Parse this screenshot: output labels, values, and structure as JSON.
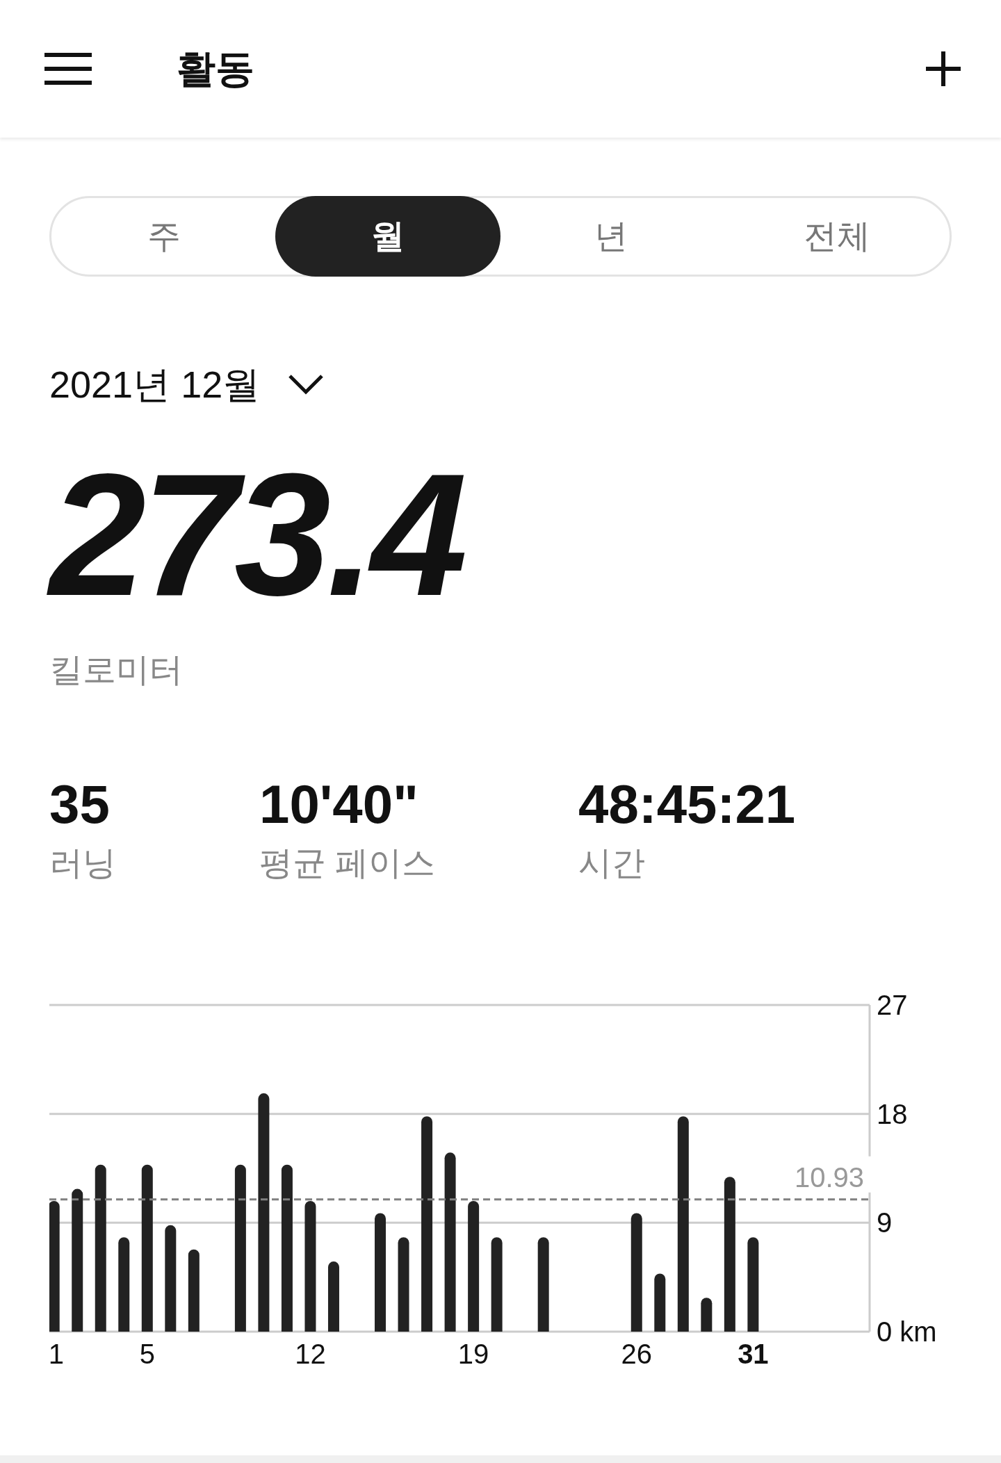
{
  "header": {
    "title": "활동"
  },
  "tabs": [
    {
      "label": "주",
      "selected": false
    },
    {
      "label": "월",
      "selected": true
    },
    {
      "label": "년",
      "selected": false
    },
    {
      "label": "전체",
      "selected": false
    }
  ],
  "period": {
    "label": "2021년 12월"
  },
  "total": {
    "value": "273.4",
    "unit": "킬로미터"
  },
  "stats": [
    {
      "value": "35",
      "label": "러닝"
    },
    {
      "value": "10'40\"",
      "label": "평균 페이스"
    },
    {
      "value": "48:45:21",
      "label": "시간"
    }
  ],
  "chart": {
    "chart_data": {
      "type": "bar",
      "x": [
        1,
        2,
        3,
        4,
        5,
        6,
        7,
        8,
        9,
        10,
        11,
        12,
        13,
        14,
        15,
        16,
        17,
        18,
        19,
        20,
        21,
        22,
        23,
        24,
        25,
        26,
        27,
        28,
        29,
        30,
        31
      ],
      "values": [
        10.8,
        11.8,
        13.8,
        7.8,
        13.8,
        8.8,
        6.8,
        0,
        13.8,
        19.7,
        13.8,
        10.8,
        5.8,
        0,
        9.8,
        7.8,
        17.8,
        14.8,
        10.8,
        7.8,
        0,
        7.8,
        0,
        0,
        0,
        9.8,
        4.8,
        17.8,
        2.8,
        12.8,
        7.8
      ],
      "ylim": [
        0,
        27
      ],
      "yticks": [
        {
          "value": 0,
          "label": "0 km"
        },
        9,
        18,
        27
      ],
      "xlim": [
        0.8,
        36
      ],
      "xticks": [
        {
          "value": 1,
          "label": "1"
        },
        {
          "value": 5,
          "label": "5"
        },
        {
          "value": 12,
          "label": "12"
        },
        {
          "value": 19,
          "label": "19"
        },
        {
          "value": 26,
          "label": "26"
        },
        {
          "value": 31,
          "label": "31"
        }
      ],
      "ref_lines": [
        {
          "axis": "y",
          "value": 10.93,
          "label": "10.93"
        }
      ]
    },
    "xtick_bold": [
      false,
      false,
      false,
      false,
      false,
      true
    ]
  }
}
